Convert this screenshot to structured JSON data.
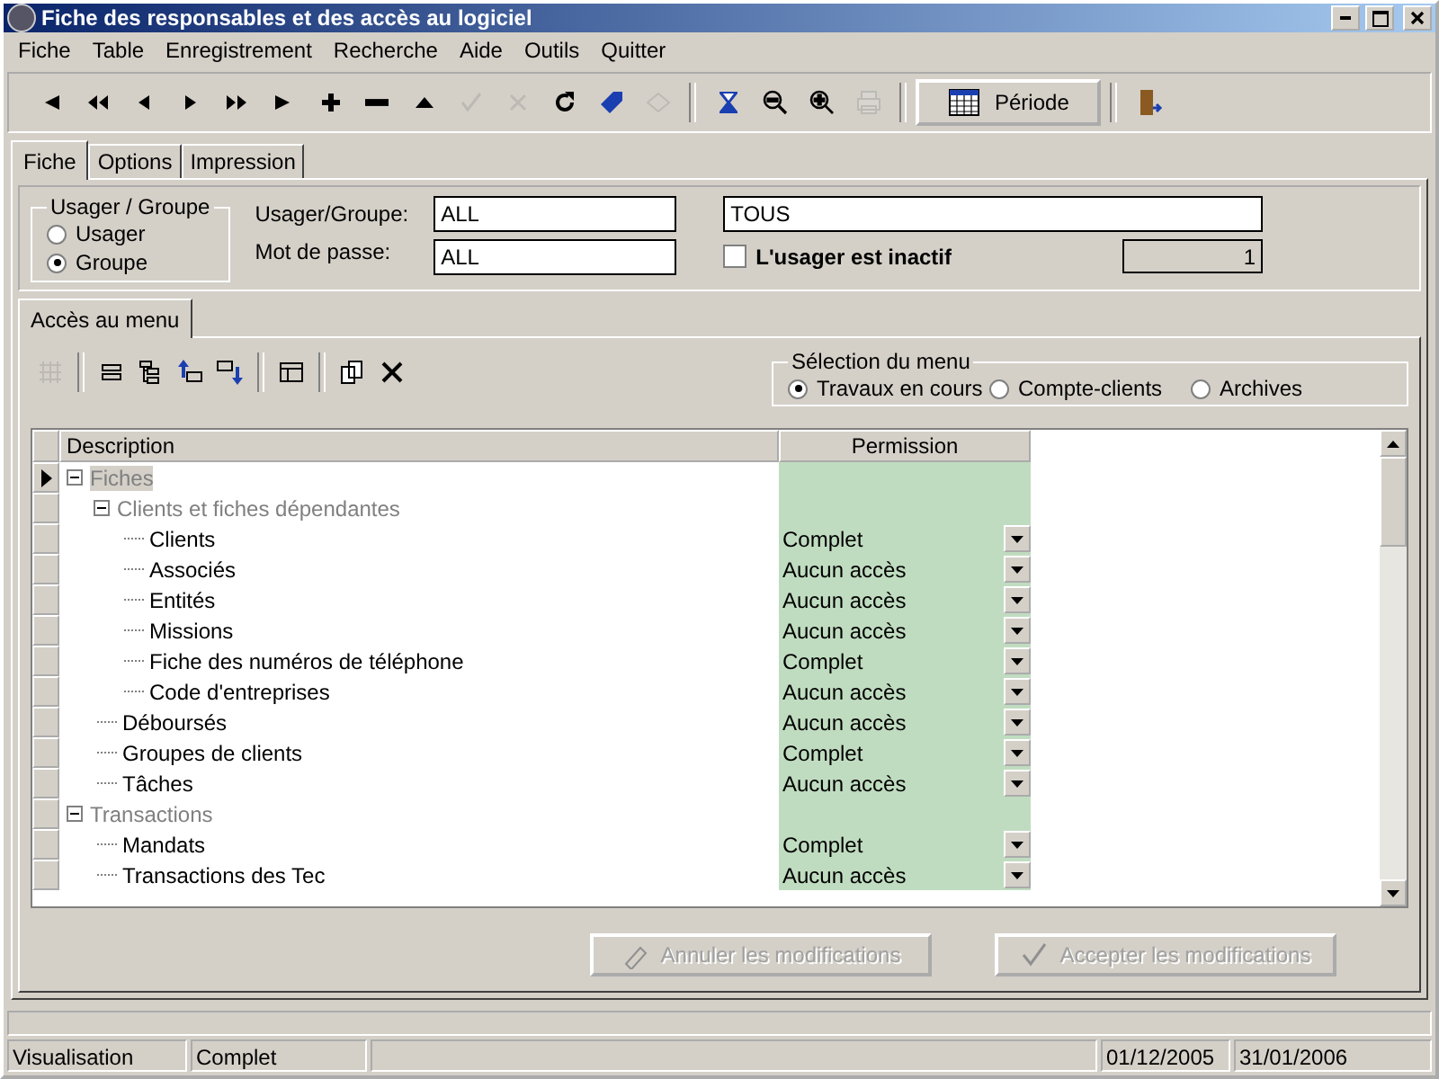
{
  "window": {
    "title": "Fiche des responsables et des accès au logiciel"
  },
  "menu": [
    "Fiche",
    "Table",
    "Enregistrement",
    "Recherche",
    "Aide",
    "Outils",
    "Quitter"
  ],
  "toolbar": [
    {
      "disabled": false
    },
    {
      "disabled": false
    },
    {
      "disabled": false
    },
    {
      "disabled": false
    },
    {
      "disabled": false
    },
    {
      "disabled": false
    },
    {
      "disabled": false
    },
    {
      "disabled": false
    },
    {
      "disabled": false
    },
    {
      "disabled": true
    },
    {
      "disabled": true
    },
    {
      "disabled": false
    },
    {
      "disabled": false
    },
    {
      "disabled": true
    },
    {
      "disabled": false
    },
    {
      "disabled": false
    },
    {
      "disabled": false
    },
    {
      "disabled": true
    }
  ],
  "period_button": {
    "label": "Période"
  },
  "tabs": [
    {
      "label": "Fiche",
      "selected": true
    },
    {
      "label": "Options",
      "selected": false
    },
    {
      "label": "Impression",
      "selected": false
    }
  ],
  "user_group": {
    "title": "Usager / Groupe",
    "options": [
      {
        "label": "Usager",
        "selected": false
      },
      {
        "label": "Groupe",
        "selected": true
      }
    ]
  },
  "fields": {
    "user_label": "Usager/Groupe:",
    "user_value": "ALL",
    "password_label": "Mot de passe:",
    "password_value": "ALL",
    "name_value": "TOUS",
    "inactive_label": "L'usager est inactif",
    "inactive_checked": false,
    "count": "1"
  },
  "inner_tab": {
    "label": "Accès au menu",
    "selected": true
  },
  "inner_toolbar": [
    {
      "disabled": true
    },
    {
      "disabled": false
    },
    {
      "disabled": false
    },
    {
      "disabled": false
    },
    {
      "disabled": false
    },
    {
      "disabled": false
    },
    {
      "disabled": false
    },
    {
      "disabled": false
    }
  ],
  "menu_selection": {
    "title": "Sélection du menu",
    "options": [
      {
        "label": "Travaux en cours",
        "selected": true
      },
      {
        "label": "Compte-clients",
        "selected": false
      },
      {
        "label": "Archives",
        "selected": false
      }
    ]
  },
  "table": {
    "columns": [
      "Description",
      "Permission"
    ],
    "rows": [
      {
        "kind": "group",
        "label": "Fiches",
        "selected": true,
        "expanded": true,
        "children": [
          {
            "kind": "group",
            "label": "Clients et fiches dépendantes",
            "selected": false,
            "expanded": true,
            "children": [
              {
                "kind": "item",
                "label": "Clients",
                "permission": "Complet",
                "selected": false
              },
              {
                "kind": "item",
                "label": "Associés",
                "permission": "Aucun accès",
                "selected": false
              },
              {
                "kind": "item",
                "label": "Entités",
                "permission": "Aucun accès",
                "selected": false
              },
              {
                "kind": "item",
                "label": "Missions",
                "permission": "Aucun accès",
                "selected": false
              },
              {
                "kind": "item",
                "label": "Fiche des numéros de téléphone",
                "permission": "Complet",
                "selected": false
              },
              {
                "kind": "item",
                "label": "Code d'entreprises",
                "permission": "Aucun accès",
                "selected": false
              }
            ]
          },
          {
            "kind": "item",
            "label": "Déboursés",
            "permission": "Aucun accès",
            "selected": false
          },
          {
            "kind": "item",
            "label": "Groupes de clients",
            "permission": "Complet",
            "selected": false
          },
          {
            "kind": "item",
            "label": "Tâches",
            "permission": "Aucun accès",
            "selected": false
          }
        ]
      },
      {
        "kind": "group",
        "label": "Transactions",
        "selected": false,
        "expanded": true,
        "children": [
          {
            "kind": "item",
            "label": "Mandats",
            "permission": "Complet",
            "selected": false
          },
          {
            "kind": "item",
            "label": "Transactions des Tec",
            "permission": "Aucun accès",
            "selected": false
          }
        ]
      }
    ]
  },
  "buttons": [
    {
      "label": "Annuler les modifications",
      "disabled": true
    },
    {
      "label": "Accepter les modifications",
      "disabled": true
    }
  ],
  "status_bar": {
    "mode": "Visualisation",
    "access": "Complet",
    "start_date": "01/12/2005",
    "end_date": "31/01/2006"
  }
}
